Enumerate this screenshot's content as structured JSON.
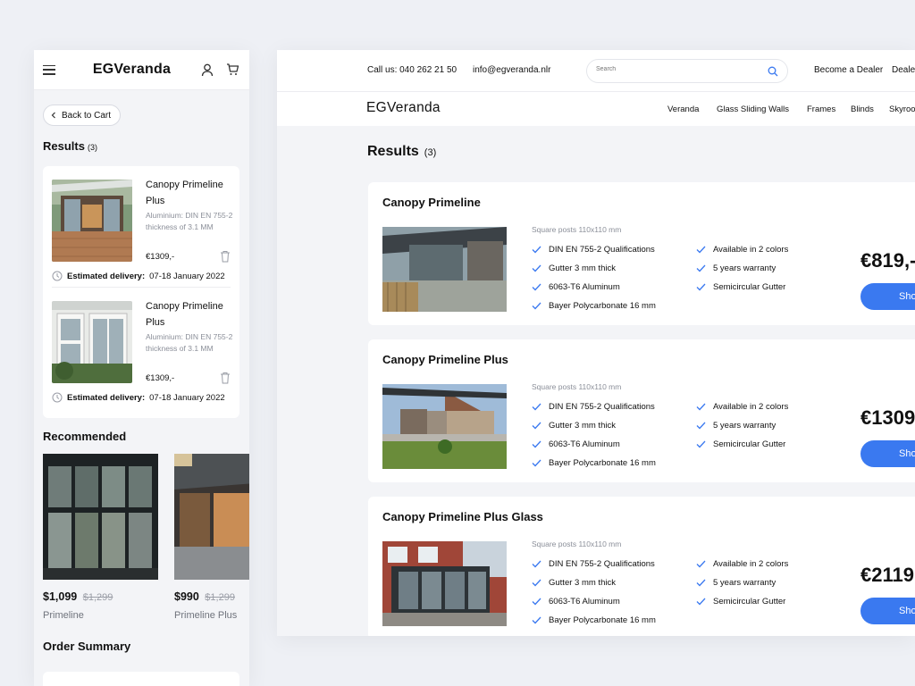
{
  "mobile": {
    "logo": "EGVeranda",
    "back_label": "Back to Cart",
    "results_title": "Results",
    "results_count": "(3)",
    "cart_items": [
      {
        "title": "Canopy Primeline Plus",
        "desc": "Aluminium: DIN EN 755-2 thickness of 3.1 MM",
        "desc_label": "Aluminium:",
        "desc_rest": "DIN EN 755-2 thickness of 3.1 MM",
        "price": "€1309,-",
        "delivery_label": "Estimated delivery:",
        "delivery_value": "07-18 January 2022"
      },
      {
        "title": "Canopy Primeline Plus",
        "desc_label": "Aluminium:",
        "desc_rest": "DIN EN 755-2 thickness of 3.1 MM",
        "price": "€1309,-",
        "delivery_label": "Estimated delivery:",
        "delivery_value": "07-18 January 2022"
      }
    ],
    "recommended_title": "Recommended",
    "recommended": [
      {
        "price": "$1,099",
        "old_price": "$1,299",
        "name": "Primeline"
      },
      {
        "price": "$990",
        "old_price": "$1,299",
        "name": "Primeline Plus"
      }
    ],
    "order_summary_title": "Order Summary"
  },
  "desktop": {
    "call": "Call us: 040 262 21 50",
    "email": "info@egveranda.nlr",
    "search_placeholder": "Search",
    "become_dealer": "Become a Dealer",
    "dealer_cut": "Deale",
    "logo": "EGVeranda",
    "nav": [
      "Veranda",
      "Glass Sliding Walls",
      "Frames",
      "Blinds",
      "Skyroo"
    ],
    "results_title": "Results",
    "results_count": "(3)",
    "products": [
      {
        "title": "Canopy Primeline",
        "subtitle": "Square posts 110x110 mm",
        "features_left": [
          "DIN EN 755-2 Qualifications",
          "Gutter 3 mm thick",
          "6063-T6 Aluminum",
          "Bayer Polycarbonate 16 mm"
        ],
        "features_right": [
          "Available in 2 colors",
          "5 years warranty",
          "Semicircular Gutter"
        ],
        "price": "€819,-",
        "button": "Sho"
      },
      {
        "title": "Canopy Primeline Plus",
        "subtitle": "Square posts 110x110 mm",
        "features_left": [
          "DIN EN 755-2 Qualifications",
          "Gutter 3 mm thick",
          "6063-T6 Aluminum",
          "Bayer Polycarbonate 16 mm"
        ],
        "features_right": [
          "Available in 2 colors",
          "5 years warranty",
          "Semicircular Gutter"
        ],
        "price": "€1309",
        "button": "Sho"
      },
      {
        "title": "Canopy Primeline Plus Glass",
        "subtitle": "Square posts 110x110 mm",
        "features_left": [
          "DIN EN 755-2 Qualifications",
          "Gutter 3 mm thick",
          "6063-T6 Aluminum",
          "Bayer Polycarbonate 16 mm"
        ],
        "features_right": [
          "Available in 2 colors",
          "5 years warranty",
          "Semicircular Gutter"
        ],
        "price": "€2119,",
        "button": "Sho"
      }
    ]
  },
  "colors": {
    "accent": "#3a79f0",
    "check": "#3a79f0",
    "muted": "#8b8f99"
  },
  "icons": [
    "menu-icon",
    "user-icon",
    "cart-icon",
    "chevron-left-icon",
    "trash-icon",
    "clock-icon",
    "search-icon",
    "check-icon"
  ]
}
